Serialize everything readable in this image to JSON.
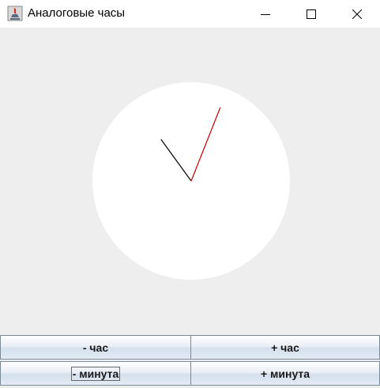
{
  "window": {
    "title": "Аналоговые часы",
    "app_icon": "java-cup-icon",
    "controls": [
      "minimize-icon",
      "maximize-icon",
      "close-icon"
    ]
  },
  "clock": {
    "face_color": "#ffffff",
    "background_color": "#eeeeee",
    "hour_hand_color": "#000000",
    "minute_hand_color": "#cc0000",
    "hour_hand_hour": 10.8,
    "minute_hand_minute": 3.6
  },
  "controls": {
    "hour_minus_label": "- час",
    "hour_plus_label": "+ час",
    "minute_minus_label": "- минута",
    "minute_plus_label": "+ минута"
  }
}
